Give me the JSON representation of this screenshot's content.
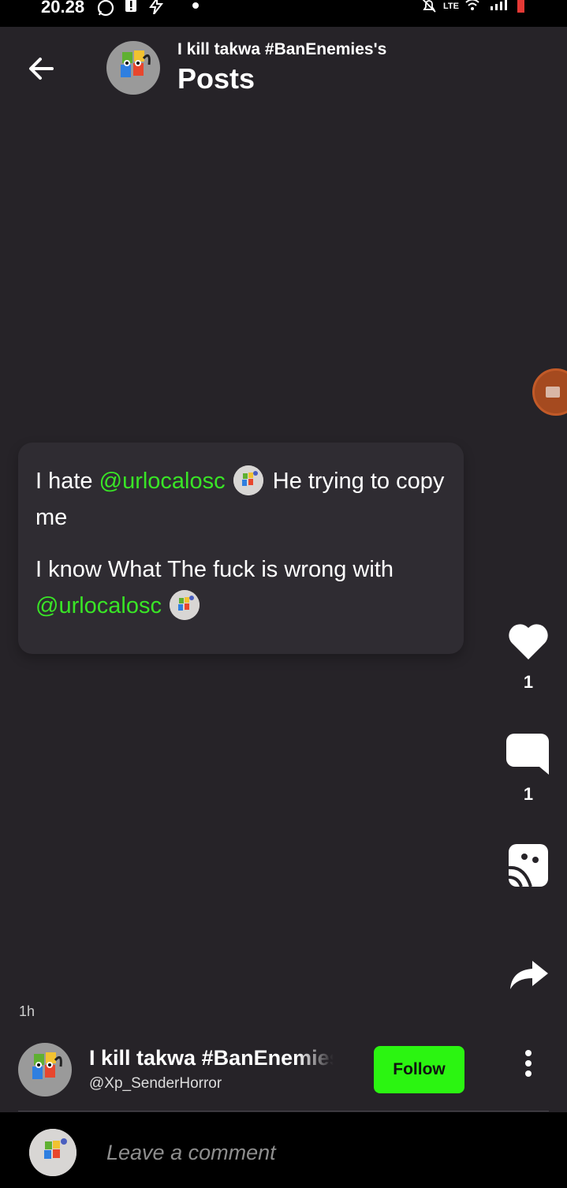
{
  "status_bar": {
    "time": "20.28",
    "network_label": "LTE"
  },
  "header": {
    "subtitle": "I kill takwa #BanEnemies's",
    "title": "Posts"
  },
  "post": {
    "paragraph1": {
      "before": "I hate ",
      "mention": "@urlocalosc",
      "after": " He trying to copy me"
    },
    "paragraph2": {
      "before": "I know What The fuck is wrong with ",
      "mention": "@urlocalosc"
    },
    "timestamp": "1h"
  },
  "actions": {
    "like_count": "1",
    "comment_count": "1"
  },
  "author": {
    "name": "I kill takwa #BanEnemies",
    "handle": "@Xp_SenderHorror",
    "follow_label": "Follow"
  },
  "comment": {
    "placeholder": "Leave a comment"
  },
  "colors": {
    "background": "#262328",
    "card": "#2f2c32",
    "mention": "#39e526",
    "follow": "#2bf511",
    "bubble": "#a54a1f"
  },
  "icons": [
    "back-arrow-icon",
    "heart-icon",
    "comment-icon",
    "stitch-icon",
    "share-icon",
    "more-vertical-icon",
    "video-icon"
  ]
}
